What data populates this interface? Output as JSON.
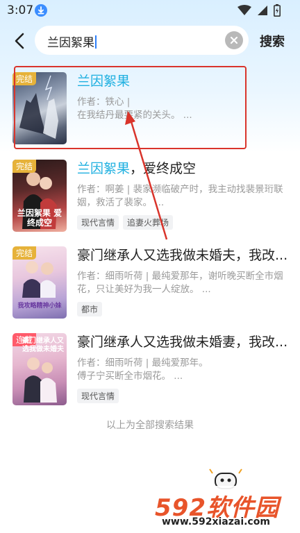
{
  "status_bar": {
    "time": "3:07"
  },
  "search": {
    "query": "兰因絮果",
    "button": "搜索"
  },
  "results": [
    {
      "title_highlight": "兰因絮果",
      "title_rest": "",
      "author": "作者：铁心 |",
      "desc": "在我结丹最要紧的关头。 ...",
      "badge": "完结",
      "tags": []
    },
    {
      "title_highlight": "兰因絮果",
      "title_rest": "，爱终成空",
      "author": "作者：啊姜 | 裴家濒临破产时，我主动找裴景珩联",
      "desc": "姻，救活了裴家。 ...",
      "badge": "完结",
      "tags": [
        "现代言情",
        "追妻火葬场"
      ],
      "cover_text": "兰因絮果 爱终成空"
    },
    {
      "title_highlight": "",
      "title_rest": "豪门继承人又选我做未婚夫，我改...",
      "author": "作者：细雨听荷 | 最纯爱那年，谢听晚买断全市烟",
      "desc": "花，只让美好为我一人绽放。 ...",
      "badge": "完结",
      "tags": [
        "都市"
      ],
      "cover_text": "我攻略精神小妹"
    },
    {
      "title_highlight": "",
      "title_rest": "豪门继承人又选我做未婚妻，我改...",
      "author": "作者：细雨听荷 | 最纯爱那年。",
      "desc": "傅子宁买断全市烟花。 ...",
      "badge": "连载",
      "tags": [
        "现代言情"
      ],
      "cover_text": "豪门继承人又选我做未婚夫"
    }
  ],
  "footer": {
    "end_text": "以上为全部搜索结果"
  },
  "watermark": {
    "brand": "592软件园",
    "url": "www.592xiazai.com"
  },
  "colors": {
    "highlight": "#1fb0e0",
    "annotation": "#d9342b",
    "badge_done": "#e6b23a",
    "badge_serial": "#ff5b6b"
  }
}
